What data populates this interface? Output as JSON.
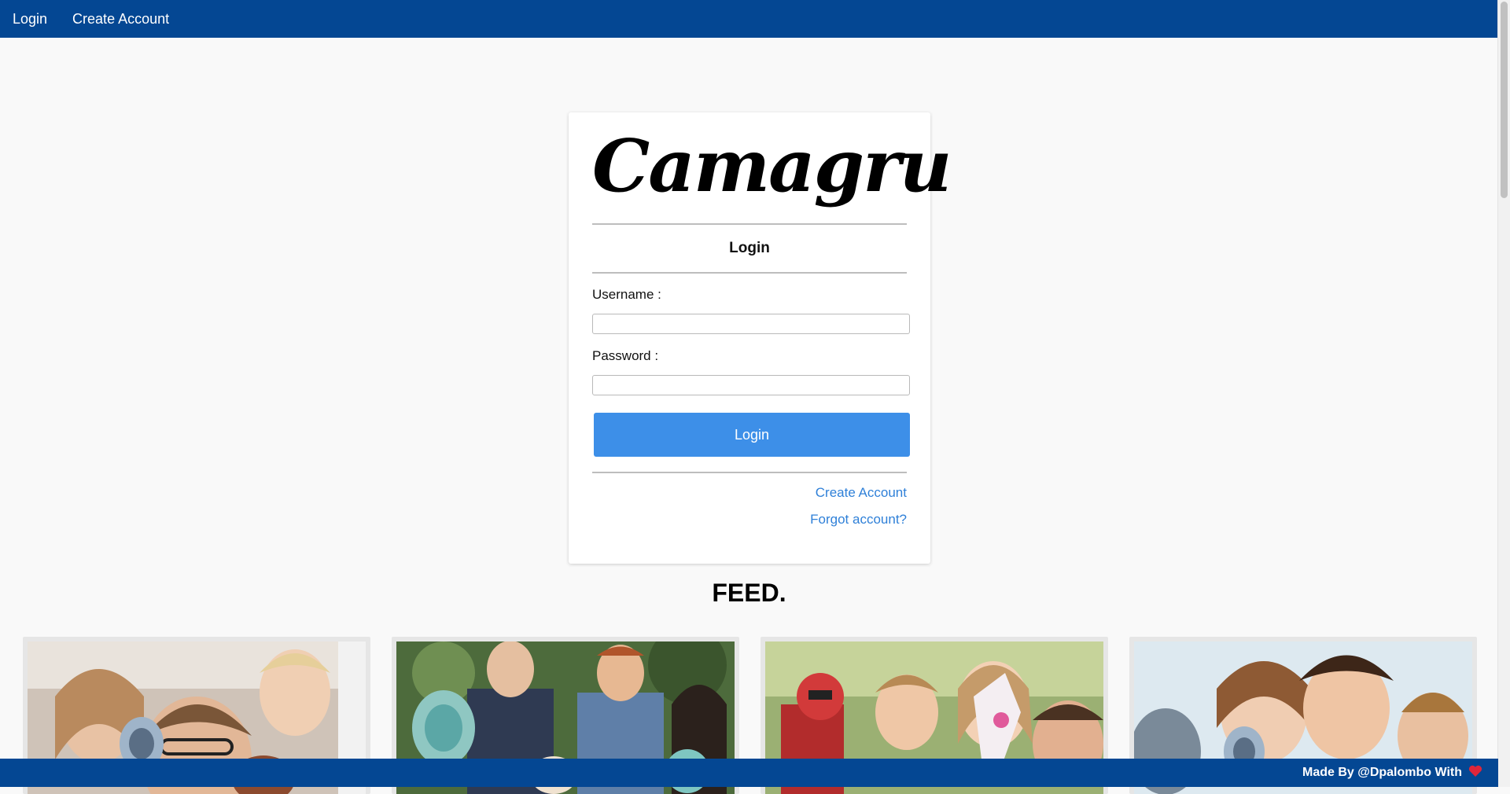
{
  "nav": {
    "login": "Login",
    "create_account": "Create Account"
  },
  "card": {
    "logo": "Camagru",
    "title": "Login",
    "username_label": "Username :",
    "password_label": "Password :",
    "submit": "Login",
    "create_account_link": "Create Account",
    "forgot_link": "Forgot account?"
  },
  "feed": {
    "title": "FEED."
  },
  "footer": {
    "text": "Made By @Dpalombo With"
  },
  "colors": {
    "navbar": "#044793",
    "button": "#3d8fe8",
    "link": "#2f80d8",
    "heart": "#e0263a"
  }
}
